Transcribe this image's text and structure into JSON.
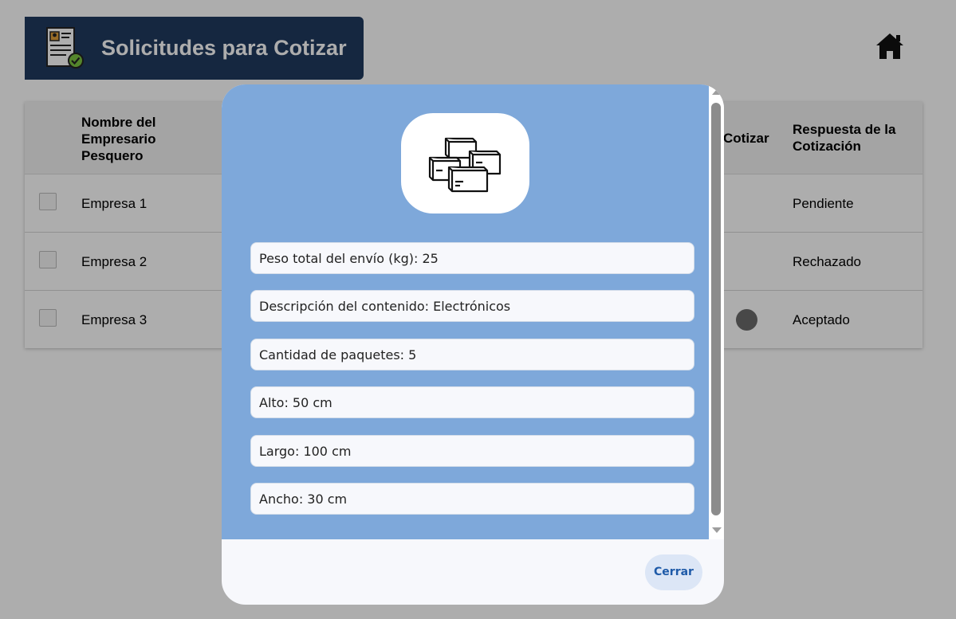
{
  "header": {
    "title": "Solicitudes para Cotizar",
    "logo_icon": "document-check-icon",
    "home_icon": "home-icon"
  },
  "table": {
    "columns": {
      "name": "Nombre del Empresario Pesquero",
      "cotizar": "Cotizar",
      "response": "Respuesta de la Cotización"
    },
    "rows": [
      {
        "name": "Empresa 1",
        "response": "Pendiente"
      },
      {
        "name": "Empresa 2",
        "response": "Rechazado"
      },
      {
        "name": "Empresa 3",
        "response": "Aceptado"
      }
    ]
  },
  "modal": {
    "icon": "boxes-icon",
    "fields": [
      "Peso total del envío (kg): 25",
      "Descripción del contenido: Electrónicos",
      "Cantidad de paquetes: 5",
      "Alto: 50 cm",
      "Largo: 100 cm",
      "Ancho: 30 cm"
    ],
    "close_label": "Cerrar"
  },
  "colors": {
    "header_bg": "#1f3a5f",
    "modal_accent": "#7ea8da",
    "button_text": "#1e5aa8"
  }
}
